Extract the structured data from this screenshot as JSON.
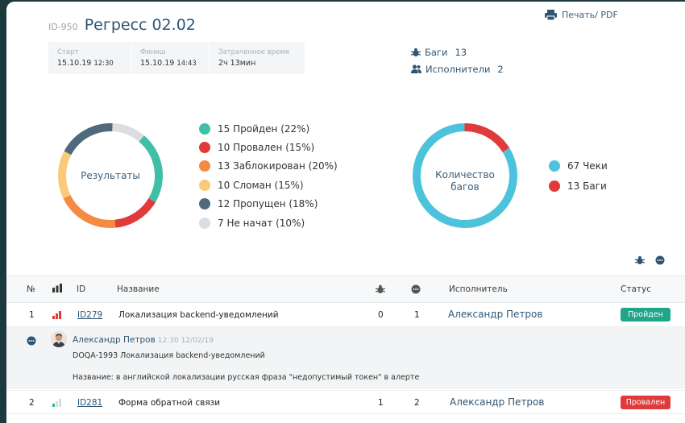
{
  "toolbar": {
    "print_label": "Печать/ PDF"
  },
  "run": {
    "id": "ID-950",
    "title": "Регресс 02.02"
  },
  "times": [
    {
      "label": "Старт",
      "date": "15.10.19",
      "time": "12:30"
    },
    {
      "label": "Финиш",
      "date": "15.10.19",
      "time": "14:43"
    },
    {
      "label": "Затраченное время",
      "date": "2ч 13мин",
      "time": ""
    }
  ],
  "meta": {
    "bugs_label": "Баги",
    "bugs_count": "13",
    "assignees_label": "Исполнители",
    "assignees_count": "2"
  },
  "results": {
    "center_label": "Результаты",
    "items": [
      {
        "label": "15 Пройден (22%)",
        "value": 15,
        "color": "#3fbfa6"
      },
      {
        "label": "10 Провален (15%)",
        "value": 10,
        "color": "#e03a3a"
      },
      {
        "label": "13 Заблокирован (20%)",
        "value": 13,
        "color": "#f58a42"
      },
      {
        "label": "10 Сломан (15%)",
        "value": 10,
        "color": "#fbc97a"
      },
      {
        "label": "12 Пропущен (18%)",
        "value": 12,
        "color": "#4f6a7c"
      },
      {
        "label": "7 Не начат (10%)",
        "value": 7,
        "color": "#dcdde0"
      }
    ]
  },
  "bugs_chart": {
    "center_label_1": "Количество",
    "center_label_2": "багов",
    "items": [
      {
        "label": "67 Чеки",
        "value": 67,
        "color": "#4cc3da"
      },
      {
        "label": "13 Баги",
        "value": 13,
        "color": "#e03a3a"
      }
    ]
  },
  "table": {
    "headers": {
      "num": "№",
      "id": "ID",
      "name": "Название",
      "assignee": "Исполнитель",
      "status": "Статус"
    },
    "rows": [
      {
        "num": "1",
        "id": "ID279",
        "name": "Локализация backend-уведомлений",
        "bugs": "0",
        "comments": "1",
        "assignee": "Александр Петров",
        "status": "Пройден",
        "status_color": "#1fa58a",
        "priority": "high"
      },
      {
        "num": "2",
        "id": "ID281",
        "name": "Форма обратной связи",
        "bugs": "1",
        "comments": "2",
        "assignee": "Александр Петров",
        "status": "Провален",
        "status_color": "#e03a3a",
        "priority": "low"
      }
    ]
  },
  "comment": {
    "author": "Александр Петров",
    "time": "12:30 12/02/19",
    "line1": "DOQA-1993 Локализация backend-уведомлений",
    "line2": "Название: в английской локализации русская фраза \"недопустимый токен\" в алерте"
  }
}
